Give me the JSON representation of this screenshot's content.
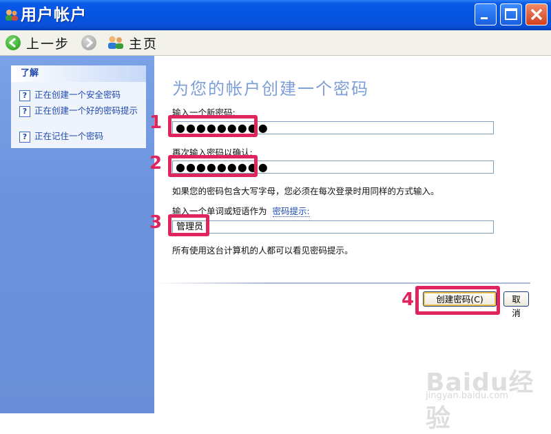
{
  "window": {
    "title": "用户帐户"
  },
  "toolbar": {
    "back_label": "上一步",
    "home_label": "主页"
  },
  "sidebar": {
    "header": "了解",
    "items": [
      {
        "label": "正在创建一个安全密码"
      },
      {
        "label": "正在创建一个好的密码提示"
      },
      {
        "label": "正在记住一个密码"
      }
    ]
  },
  "main": {
    "heading": "为您的帐户创建一个密码",
    "new_password_label": "输入一个新密码:",
    "new_password_value": "●●●●●●●●●",
    "confirm_label": "再次输入密码以确认:",
    "confirm_value": "●●●●●●●●●",
    "case_note": "如果您的密码包含大写字母，您必须在每次登录时用同样的方式输入。",
    "hint_label": "输入一个单词或短语作为",
    "hint_link": "密码提示:",
    "hint_value": "管理员",
    "hint_visibility_note": "所有使用这台计算机的人都可以看见密码提示。",
    "create_button": "创建密码(C)",
    "cancel_button": "取消"
  },
  "annotations": {
    "marker1": "1",
    "marker2": "2",
    "marker3": "3",
    "marker4": "4",
    "color": "#e0245e"
  },
  "watermark": {
    "main": "Baidu经验",
    "sub": "jingyan.baidu.com"
  }
}
